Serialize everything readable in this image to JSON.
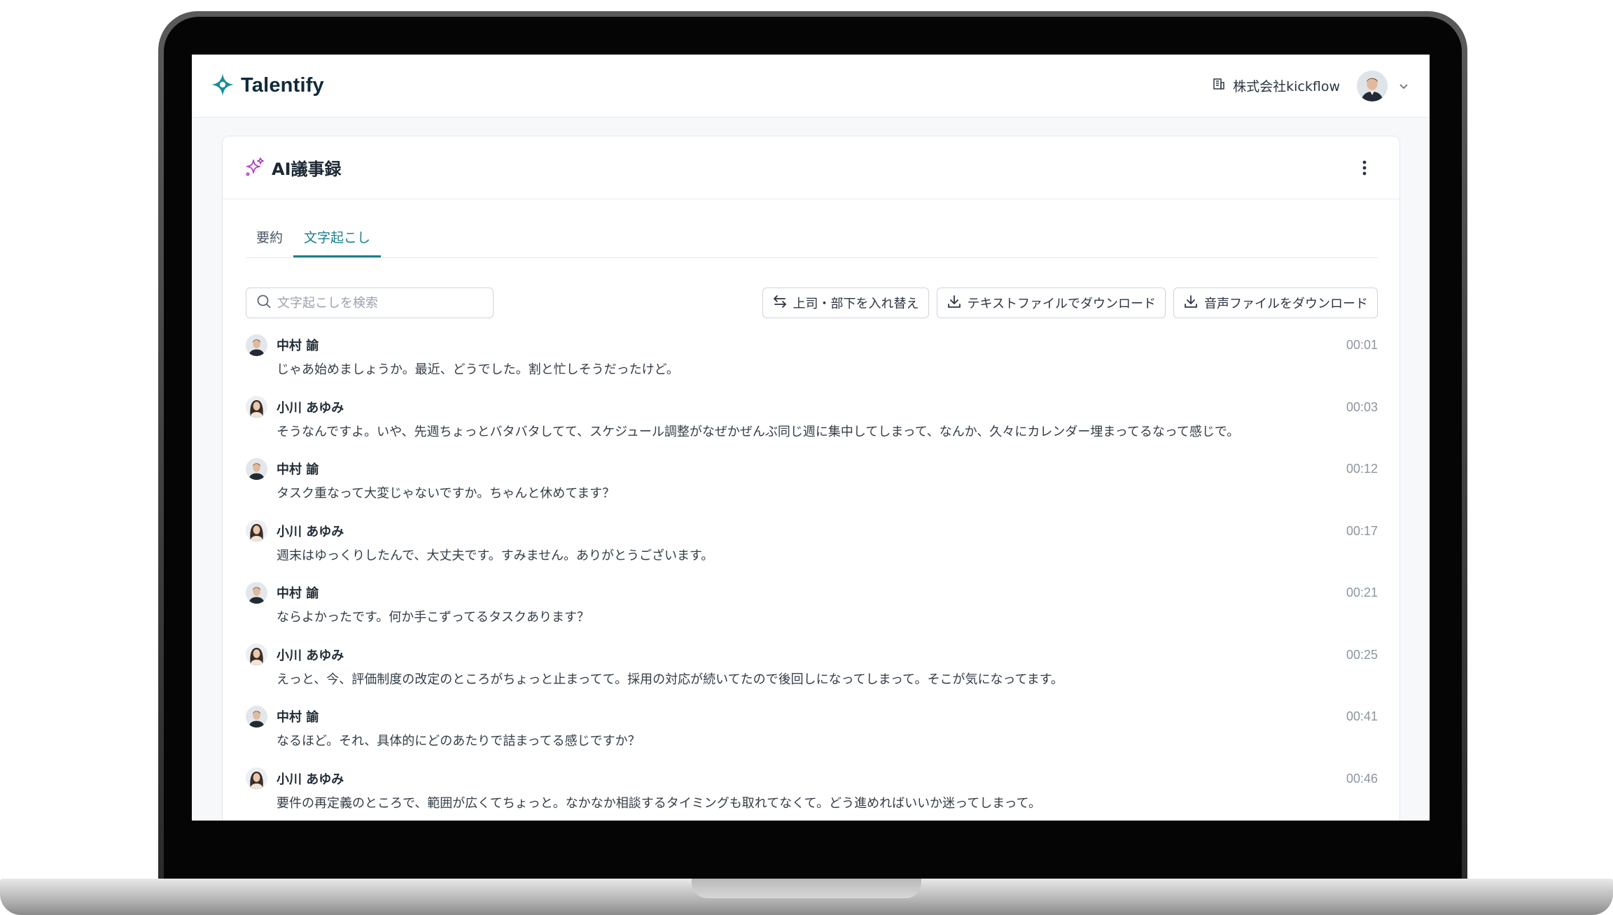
{
  "header": {
    "brand": "Talentify",
    "company": "株式会社kickflow"
  },
  "card": {
    "title": "AI議事録"
  },
  "tabs": [
    {
      "label": "要約",
      "active": false
    },
    {
      "label": "文字起こし",
      "active": true
    }
  ],
  "search": {
    "placeholder": "文字起こしを検索",
    "value": ""
  },
  "actions": {
    "swap": "上司・部下を入れ替え",
    "download_text": "テキストファイルでダウンロード",
    "download_audio": "音声ファイルをダウンロード"
  },
  "colors": {
    "accent": "#1a7f8c",
    "sparkle": "#b03fbf"
  },
  "transcript": [
    {
      "speaker": "中村 諭",
      "role": "male",
      "time": "00:01",
      "text": "じゃあ始めましょうか。最近、どうでした。割と忙しそうだったけど。"
    },
    {
      "speaker": "小川 あゆみ",
      "role": "female",
      "time": "00:03",
      "text": "そうなんですよ。いや、先週ちょっとバタバタしてて、スケジュール調整がなぜかぜんぶ同じ週に集中してしまって、なんか、久々にカレンダー埋まってるなって感じで。"
    },
    {
      "speaker": "中村 諭",
      "role": "male",
      "time": "00:12",
      "text": "タスク重なって大変じゃないですか。ちゃんと休めてます？"
    },
    {
      "speaker": "小川 あゆみ",
      "role": "female",
      "time": "00:17",
      "text": "週末はゆっくりしたんで、大丈夫です。すみません。ありがとうございます。"
    },
    {
      "speaker": "中村 諭",
      "role": "male",
      "time": "00:21",
      "text": "ならよかったです。何か手こずってるタスクあります？"
    },
    {
      "speaker": "小川 あゆみ",
      "role": "female",
      "time": "00:25",
      "text": "えっと、今、評価制度の改定のところがちょっと止まってて。採用の対応が続いてたので後回しになってしまって。そこが気になってます。"
    },
    {
      "speaker": "中村 諭",
      "role": "male",
      "time": "00:41",
      "text": "なるほど。それ、具体的にどのあたりで詰まってる感じですか？"
    },
    {
      "speaker": "小川 あゆみ",
      "role": "female",
      "time": "00:46",
      "text": "要件の再定義のところで、範囲が広くてちょっと。なかなか相談するタイミングも取れてなくて。どう進めればいいか迷ってしまって。"
    }
  ]
}
